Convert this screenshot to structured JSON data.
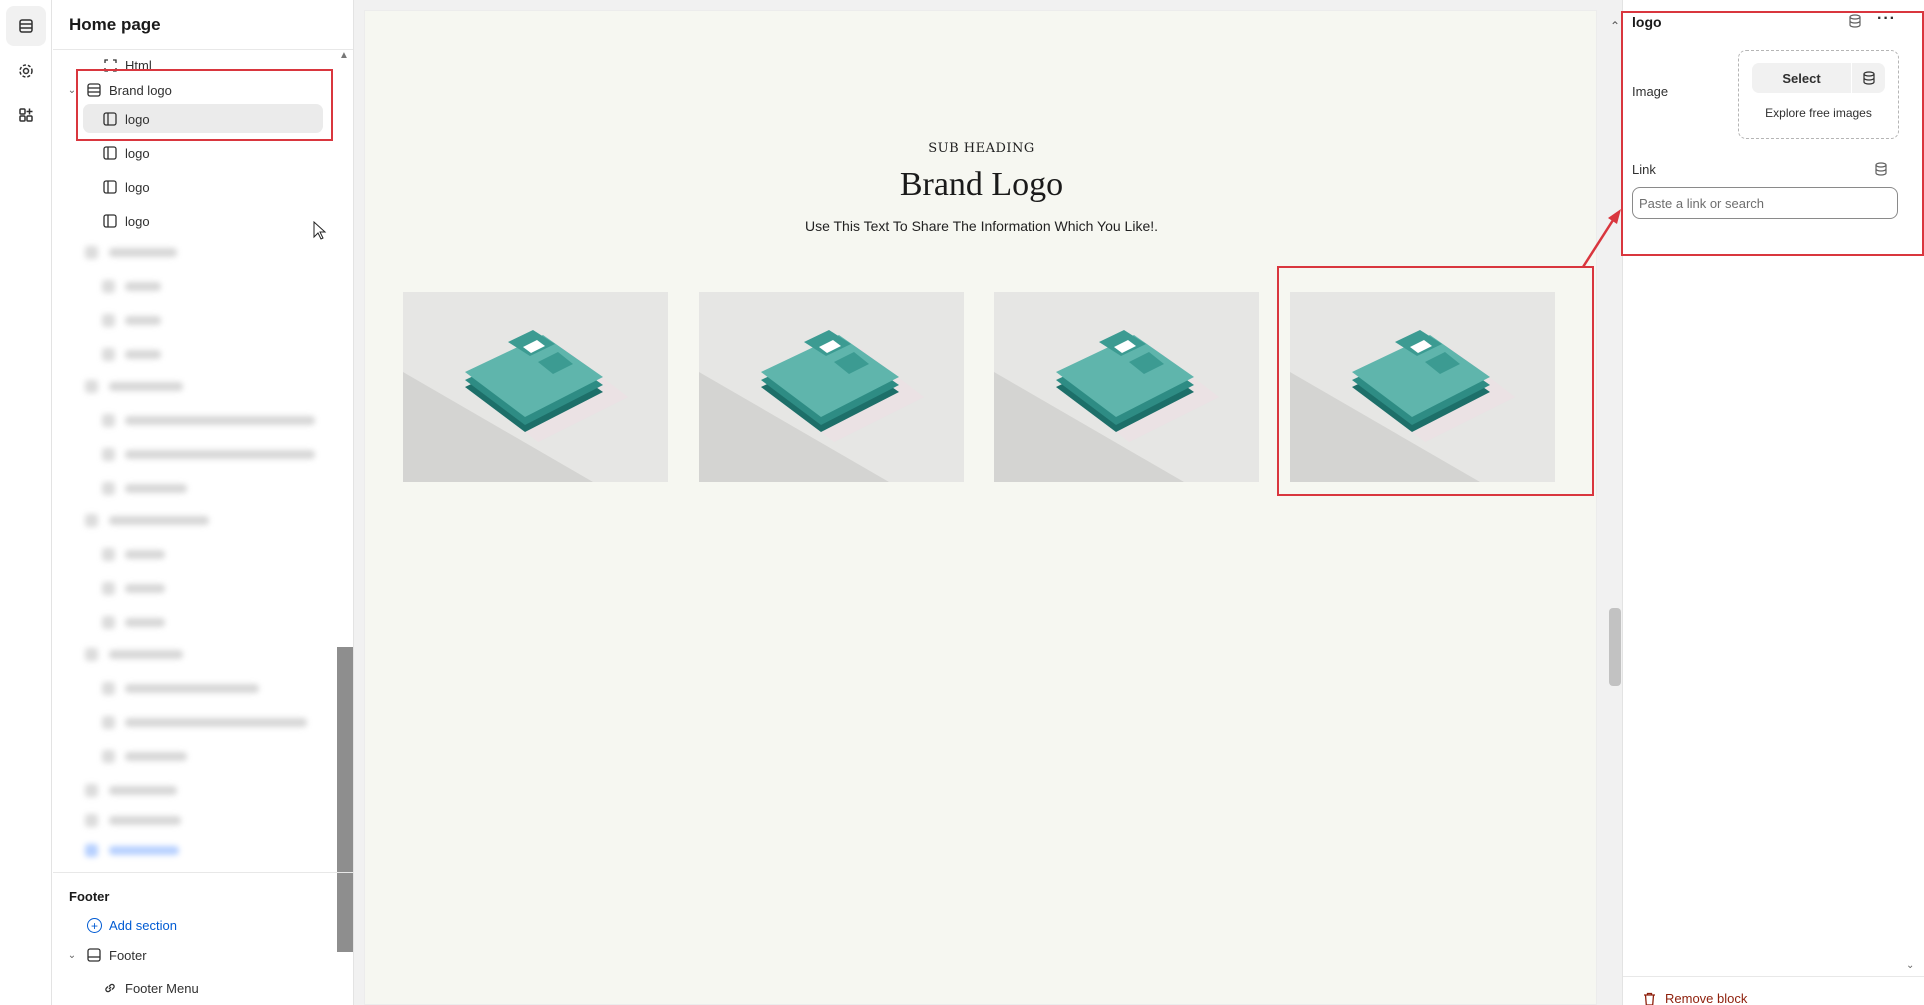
{
  "sidebar": {
    "title": "Home page",
    "items": [
      {
        "label": "Html"
      },
      {
        "label": "Brand logo"
      },
      {
        "label": "logo"
      },
      {
        "label": "logo"
      },
      {
        "label": "logo"
      },
      {
        "label": "logo"
      }
    ],
    "footer": {
      "title": "Footer",
      "add_section": "Add section",
      "section_label": "Footer",
      "menu_label": "Footer Menu"
    }
  },
  "preview": {
    "sub_heading": "SUB HEADING",
    "title": "Brand Logo",
    "description": "Use This Text To Share The Information Which You Like!.",
    "tile_count": 4
  },
  "panel": {
    "title": "logo",
    "image_label": "Image",
    "select_label": "Select",
    "explore_label": "Explore free images",
    "link_label": "Link",
    "link_placeholder": "Paste a link or search",
    "remove_label": "Remove block"
  },
  "colors": {
    "highlight": "#d9363e",
    "accent_blue": "#005bd3",
    "preview_bg": "#f6f7f1",
    "shirt": "#5fb5ac",
    "danger": "#8e1f0b"
  }
}
